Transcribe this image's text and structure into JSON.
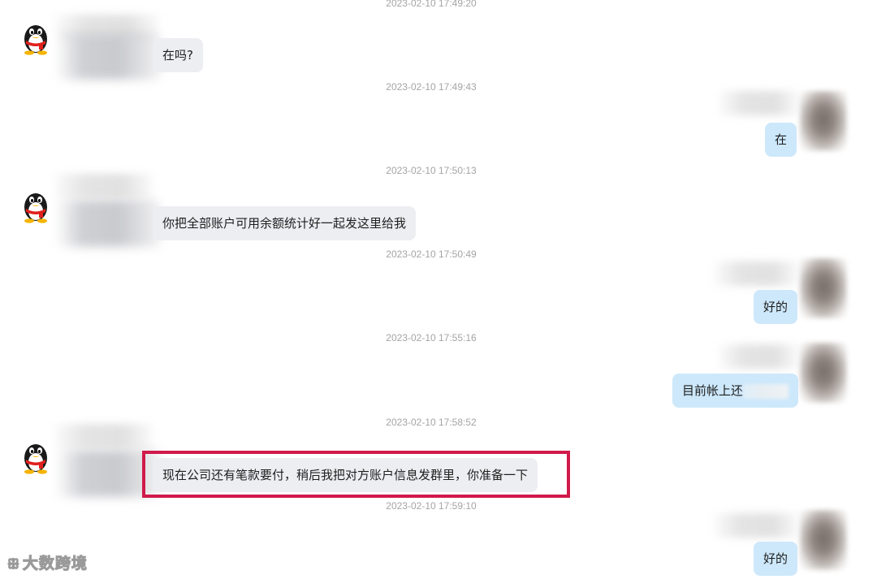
{
  "messages": [
    {
      "timestamp": "2023-02-10 17:49:20",
      "side": "left",
      "text": "在吗?"
    },
    {
      "timestamp": "2023-02-10 17:49:43",
      "side": "right",
      "text": "在"
    },
    {
      "timestamp": "2023-02-10 17:50:13",
      "side": "left",
      "text": "你把全部账户可用余额统计好一起发这里给我"
    },
    {
      "timestamp": "2023-02-10 17:50:49",
      "side": "right",
      "text": "好的"
    },
    {
      "timestamp": "2023-02-10 17:55:16",
      "side": "right",
      "text": "目前帐上还"
    },
    {
      "timestamp": "2023-02-10 17:58:52",
      "side": "left",
      "text": "现在公司还有笔款要付，稍后我把对方账户信息发群里，你准备一下"
    },
    {
      "timestamp": "2023-02-10 17:59:10",
      "side": "right",
      "text": "好的"
    }
  ],
  "watermark": {
    "logo": "ꕥ",
    "text": "大数跨境"
  },
  "colors": {
    "highlight": "#d01a4a",
    "left_bubble": "#eceef1",
    "right_bubble": "#cde8fb",
    "timestamp": "#a4a4a4"
  },
  "icons": {
    "left_avatar": "qq-penguin-icon"
  }
}
